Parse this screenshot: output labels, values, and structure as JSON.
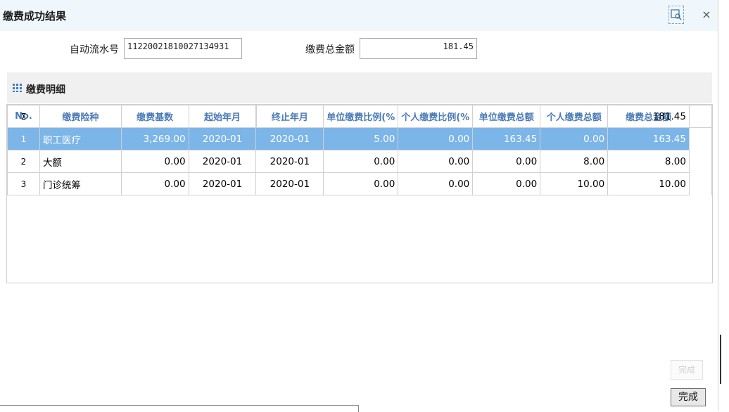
{
  "dialog": {
    "title": "缴费成功结果",
    "close_glyph": "×"
  },
  "form": {
    "serial_label": "自动流水号",
    "serial_value": "11220021810027134931",
    "total_label": "缴费总金额",
    "total_value": "181.45"
  },
  "panel": {
    "title": "缴费明细"
  },
  "table": {
    "columns": [
      "No.",
      "缴费险种",
      "缴费基数",
      "起始年月",
      "终止年月",
      "单位缴费比例(%",
      "个人缴费比例(%",
      "单位缴费总额",
      "个人缴费总额",
      "缴费总金额"
    ],
    "rows": [
      {
        "no": "1",
        "type": "职工医疗",
        "base": "3,269.00",
        "start": "2020-01",
        "end": "2020-01",
        "unit_ratio": "5.00",
        "personal_ratio": "0.00",
        "unit_total": "163.45",
        "personal_total": "0.00",
        "total": "163.45"
      },
      {
        "no": "2",
        "type": "大额",
        "base": "0.00",
        "start": "2020-01",
        "end": "2020-01",
        "unit_ratio": "0.00",
        "personal_ratio": "0.00",
        "unit_total": "0.00",
        "personal_total": "8.00",
        "total": "8.00"
      },
      {
        "no": "3",
        "type": "门诊统筹",
        "base": "0.00",
        "start": "2020-01",
        "end": "2020-01",
        "unit_ratio": "0.00",
        "personal_ratio": "0.00",
        "unit_total": "0.00",
        "personal_total": "10.00",
        "total": "10.00"
      }
    ],
    "summary": {
      "symbol": "Σ",
      "total": "181.45"
    },
    "selected_row_color": "#7cb5e8",
    "header_color": "#4a7ab6"
  },
  "buttons": {
    "ghost_label": "完成",
    "done_label": "完成"
  }
}
